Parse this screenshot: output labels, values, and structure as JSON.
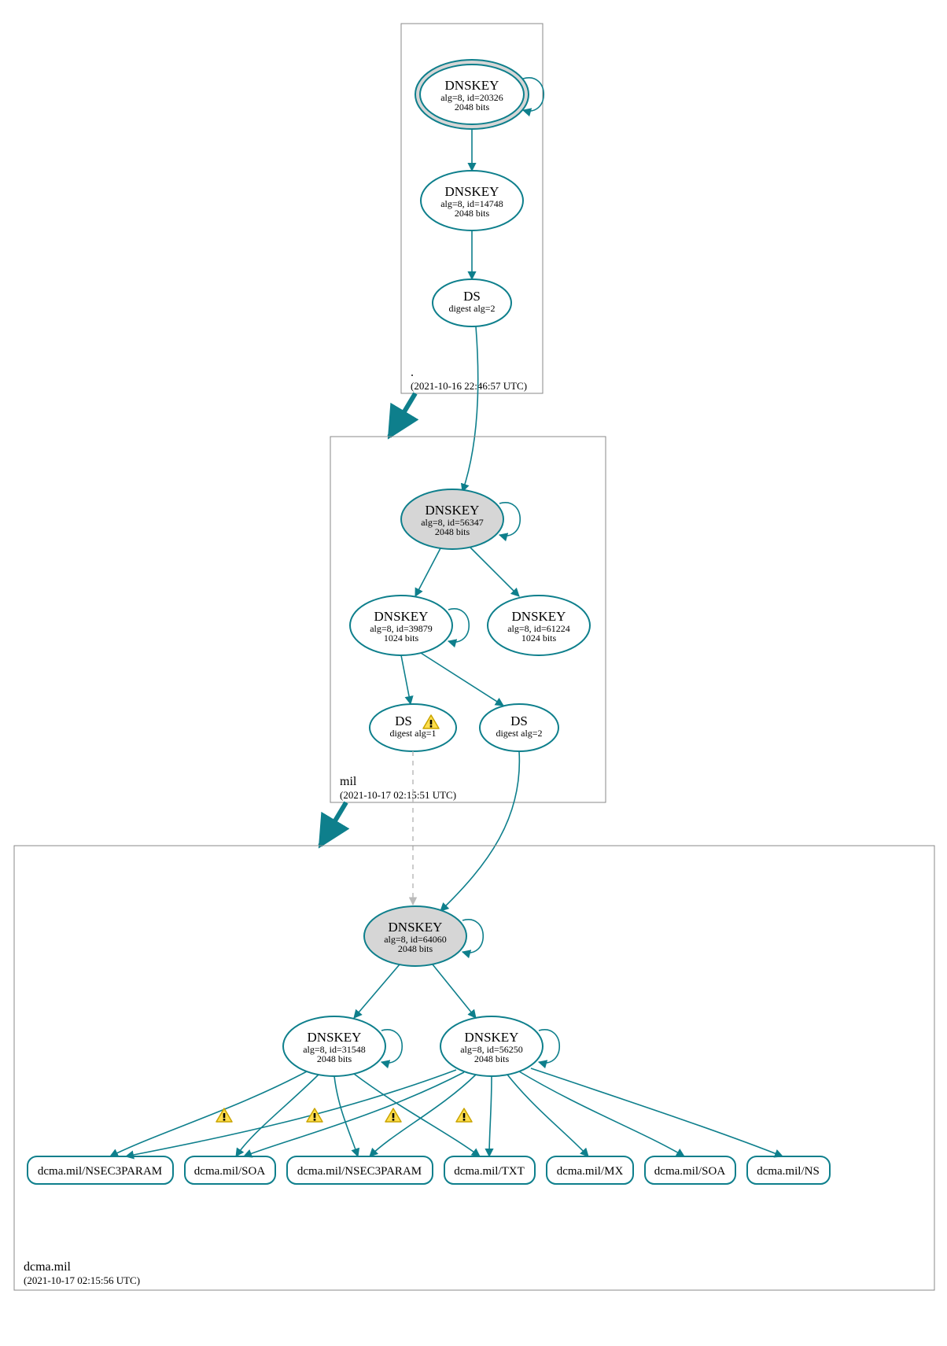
{
  "colors": {
    "stroke": "#0e7f8c",
    "fill_grey": "#d6d6d6",
    "warn_fill": "#ffde4d",
    "warn_stroke": "#c9a400"
  },
  "zones": {
    "root": {
      "label": ".",
      "timestamp": "(2021-10-16 22:46:57 UTC)"
    },
    "mil": {
      "label": "mil",
      "timestamp": "(2021-10-17 02:15:51 UTC)"
    },
    "dcma": {
      "label": "dcma.mil",
      "timestamp": "(2021-10-17 02:15:56 UTC)"
    }
  },
  "nodes": {
    "root_ksk": {
      "title": "DNSKEY",
      "line1": "alg=8, id=20326",
      "line2": "2048 bits"
    },
    "root_zsk": {
      "title": "DNSKEY",
      "line1": "alg=8, id=14748",
      "line2": "2048 bits"
    },
    "root_ds": {
      "title": "DS",
      "line1": "digest alg=2",
      "line2": ""
    },
    "mil_ksk": {
      "title": "DNSKEY",
      "line1": "alg=8, id=56347",
      "line2": "2048 bits"
    },
    "mil_zsk1": {
      "title": "DNSKEY",
      "line1": "alg=8, id=39879",
      "line2": "1024 bits"
    },
    "mil_zsk2": {
      "title": "DNSKEY",
      "line1": "alg=8, id=61224",
      "line2": "1024 bits"
    },
    "mil_ds1": {
      "title": "DS",
      "line1": "digest alg=1",
      "line2": ""
    },
    "mil_ds2": {
      "title": "DS",
      "line1": "digest alg=2",
      "line2": ""
    },
    "dcma_ksk": {
      "title": "DNSKEY",
      "line1": "alg=8, id=64060",
      "line2": "2048 bits"
    },
    "dcma_zsk1": {
      "title": "DNSKEY",
      "line1": "alg=8, id=31548",
      "line2": "2048 bits"
    },
    "dcma_zsk2": {
      "title": "DNSKEY",
      "line1": "alg=8, id=56250",
      "line2": "2048 bits"
    }
  },
  "rr": {
    "r1": "dcma.mil/NSEC3PARAM",
    "r2": "dcma.mil/SOA",
    "r3": "dcma.mil/NSEC3PARAM",
    "r4": "dcma.mil/TXT",
    "r5": "dcma.mil/MX",
    "r6": "dcma.mil/SOA",
    "r7": "dcma.mil/NS"
  }
}
